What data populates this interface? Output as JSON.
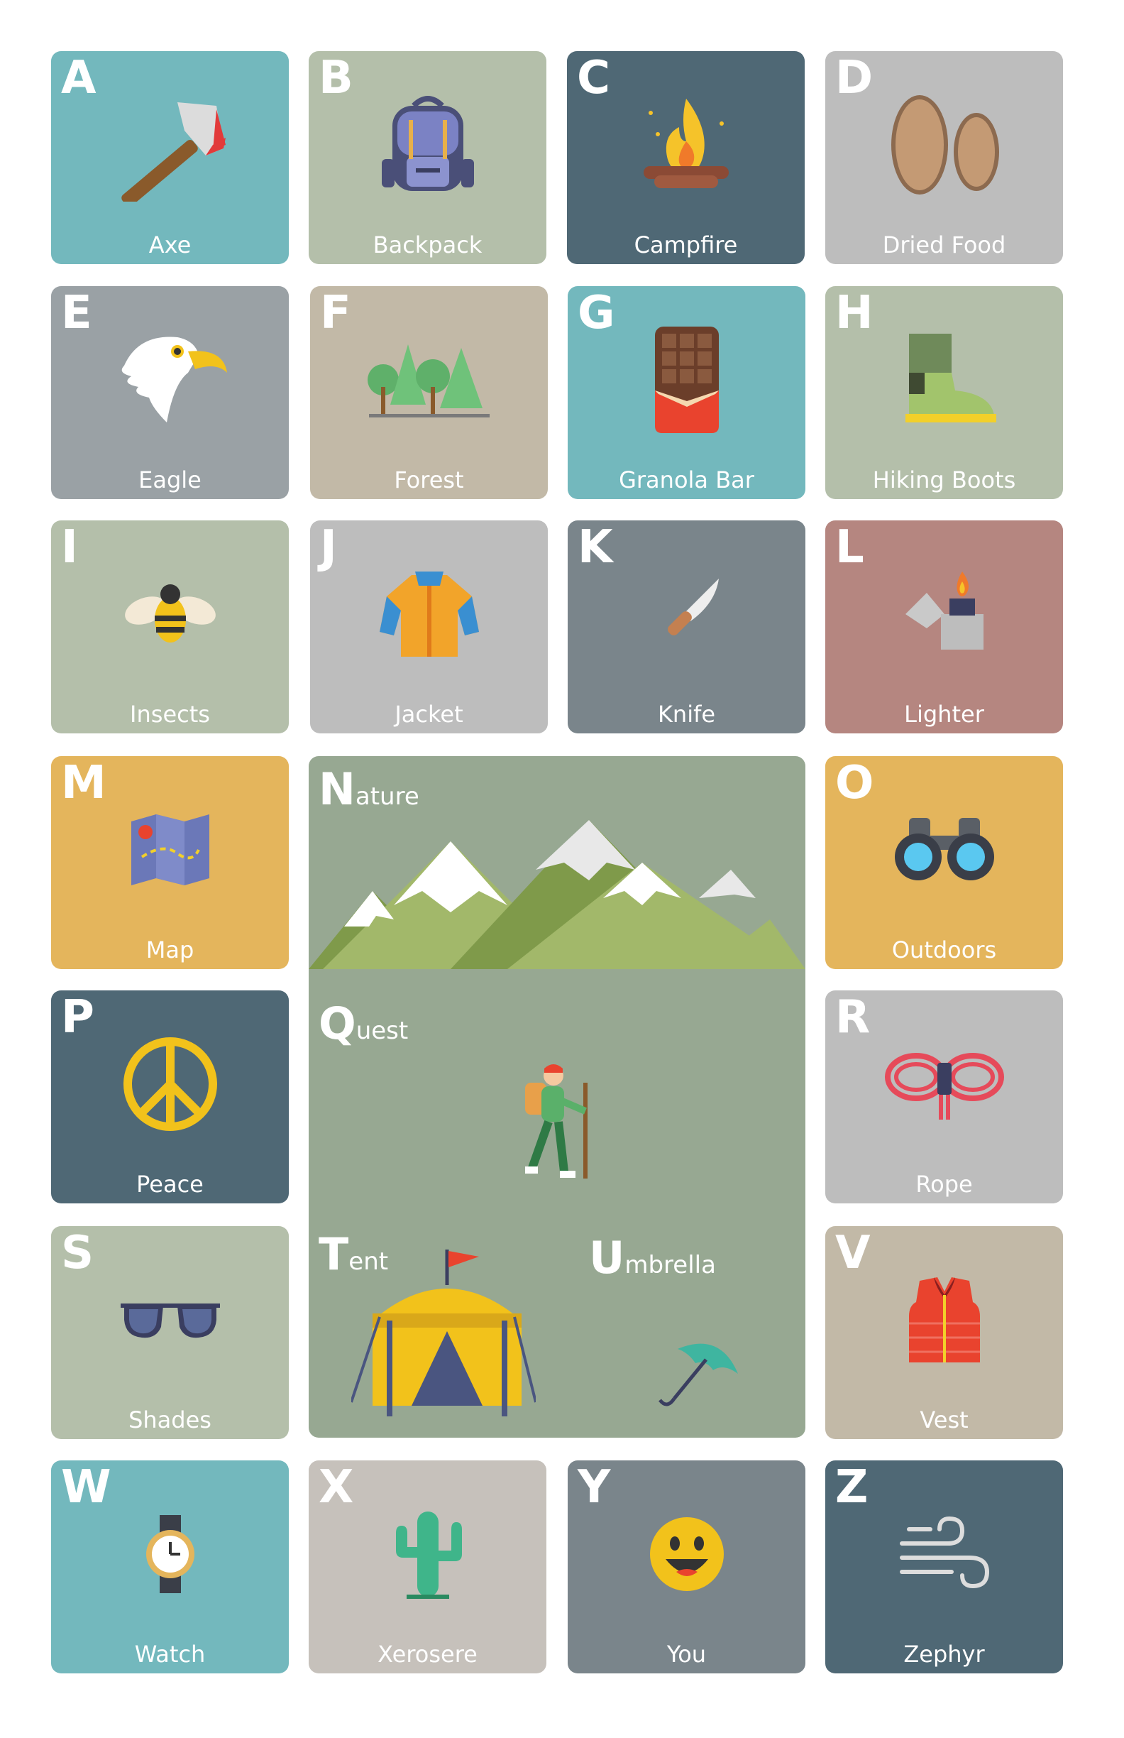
{
  "cards": [
    {
      "letter": "A",
      "label": "Axe",
      "color": "#73b8bd",
      "icon": "axe-icon"
    },
    {
      "letter": "B",
      "label": "Backpack",
      "color": "#b4bfaa",
      "icon": "backpack-icon"
    },
    {
      "letter": "C",
      "label": "Campfire",
      "color": "#4f6875",
      "icon": "campfire-icon"
    },
    {
      "letter": "D",
      "label": "Dried Food",
      "color": "#bdbdbd",
      "icon": "almond-icon"
    },
    {
      "letter": "E",
      "label": "Eagle",
      "color": "#9aa1a5",
      "icon": "eagle-icon"
    },
    {
      "letter": "F",
      "label": "Forest",
      "color": "#c2b9a7",
      "icon": "forest-icon"
    },
    {
      "letter": "G",
      "label": "Granola Bar",
      "color": "#73b8bd",
      "icon": "chocolate-bar-icon"
    },
    {
      "letter": "H",
      "label": "Hiking Boots",
      "color": "#b4bfaa",
      "icon": "boot-icon"
    },
    {
      "letter": "I",
      "label": "Insects",
      "color": "#b4bfaa",
      "icon": "bee-icon"
    },
    {
      "letter": "J",
      "label": "Jacket",
      "color": "#bdbdbd",
      "icon": "jacket-icon"
    },
    {
      "letter": "K",
      "label": "Knife",
      "color": "#7a858b",
      "icon": "knife-icon"
    },
    {
      "letter": "L",
      "label": "Lighter",
      "color": "#b58680",
      "icon": "lighter-icon"
    },
    {
      "letter": "M",
      "label": "Map",
      "color": "#e4b55c",
      "icon": "map-icon"
    },
    {
      "letter": "O",
      "label": "Outdoors",
      "color": "#e4b55c",
      "icon": "binoculars-icon"
    },
    {
      "letter": "P",
      "label": "Peace",
      "color": "#4f6875",
      "icon": "peace-icon"
    },
    {
      "letter": "R",
      "label": "Rope",
      "color": "#bdbdbd",
      "icon": "rope-icon"
    },
    {
      "letter": "S",
      "label": "Shades",
      "color": "#b4bfaa",
      "icon": "sunglasses-icon"
    },
    {
      "letter": "V",
      "label": "Vest",
      "color": "#c2b9a7",
      "icon": "vest-icon"
    },
    {
      "letter": "W",
      "label": "Watch",
      "color": "#73b8bd",
      "icon": "watch-icon"
    },
    {
      "letter": "X",
      "label": "Xerosere",
      "color": "#c6c1bb",
      "icon": "cactus-icon"
    },
    {
      "letter": "Y",
      "label": "You",
      "color": "#7a858b",
      "icon": "smiley-icon"
    },
    {
      "letter": "Z",
      "label": "Zephyr",
      "color": "#4f6875",
      "icon": "wind-icon"
    }
  ],
  "big_panel": {
    "color": "#97a892",
    "words": [
      {
        "cap": "N",
        "rest": "ature",
        "icon": "mountains-icon"
      },
      {
        "cap": "Q",
        "rest": "uest",
        "icon": "hiker-icon"
      },
      {
        "cap": "T",
        "rest": "ent",
        "icon": "tent-icon"
      },
      {
        "cap": "U",
        "rest": "mbrella",
        "icon": "umbrella-icon"
      }
    ]
  }
}
